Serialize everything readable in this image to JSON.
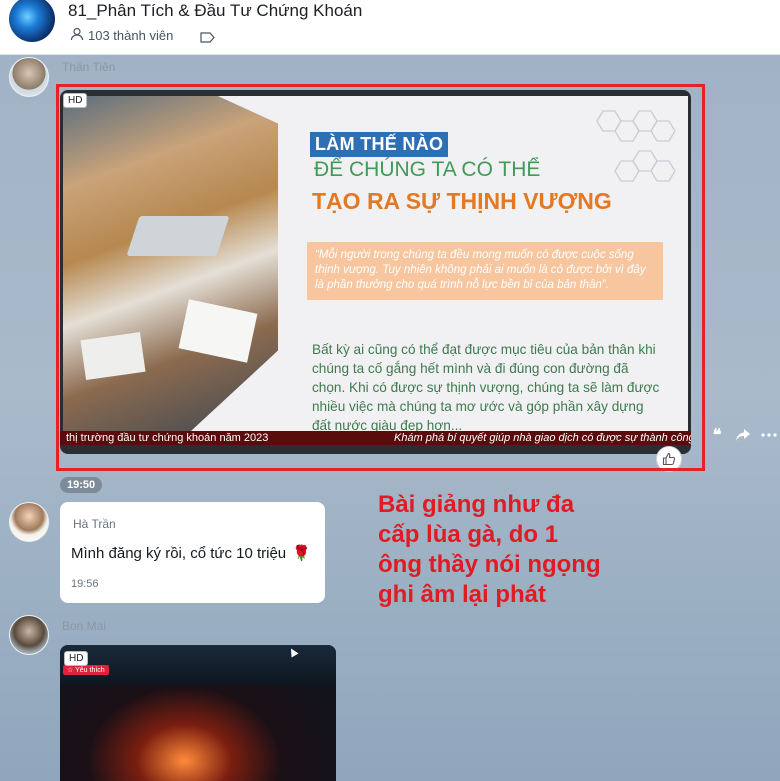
{
  "header": {
    "title": "81_Phân Tích & Đầu Tư Chứng Khoán",
    "members": "103 thành viên",
    "icons": {
      "members": "person-icon",
      "tag": "tag-icon"
    }
  },
  "messages": [
    {
      "sender": "Thần Tiên",
      "type": "video",
      "hd_label": "HD",
      "time": "19:50",
      "slide": {
        "badge": "LÀM THẾ NÀO",
        "line2": "ĐỂ CHÚNG TA CÓ THỂ",
        "line3": "TẠO RA SỰ THỊNH VƯỢNG",
        "quote": "“Mỗi người trong chúng ta đều mong muốn có được cuộc sống thịnh vượng. Tuy nhiên không phải ai muốn là có được bởi vì đây là phần thưởng cho quá trình nỗ lực bền bỉ của bản thân”.",
        "body": "Bất kỳ ai cũng có thể đạt được mục tiêu của bản thân khi chúng ta cố gắng hết mình và đi đúng con đường đã chọn. Khi có được sự thịnh vượng, chúng ta sẽ làm được nhiều việc mà chúng ta mơ ước và góp phần xây dựng đất nước giàu đẹp hơn..."
      },
      "ticker_left": "thị trường đầu tư chứng khoán năm 2023",
      "ticker_right": "Khám phá bí quyết giúp nhà giao dịch có được sự thành công"
    },
    {
      "sender": "Hà Trần",
      "type": "text",
      "text": "Mình đăng ký rồi, cổ tức 10 triệu",
      "emoji": "🌹",
      "time": "19:56"
    },
    {
      "sender": "Bon Mai",
      "type": "video",
      "hd_label": "HD",
      "yt_label": "☆ Yêu thích"
    }
  ],
  "annotation": "Bài giảng như đa cấp lùa gà, do 1 ông thầy nói ngọng ghi âm lại phát",
  "colors": {
    "frame": "#e8202a",
    "annotation": "#e01b24",
    "badge": "#2e6fb3",
    "orange": "#e27a24",
    "green": "#3f9b57"
  }
}
